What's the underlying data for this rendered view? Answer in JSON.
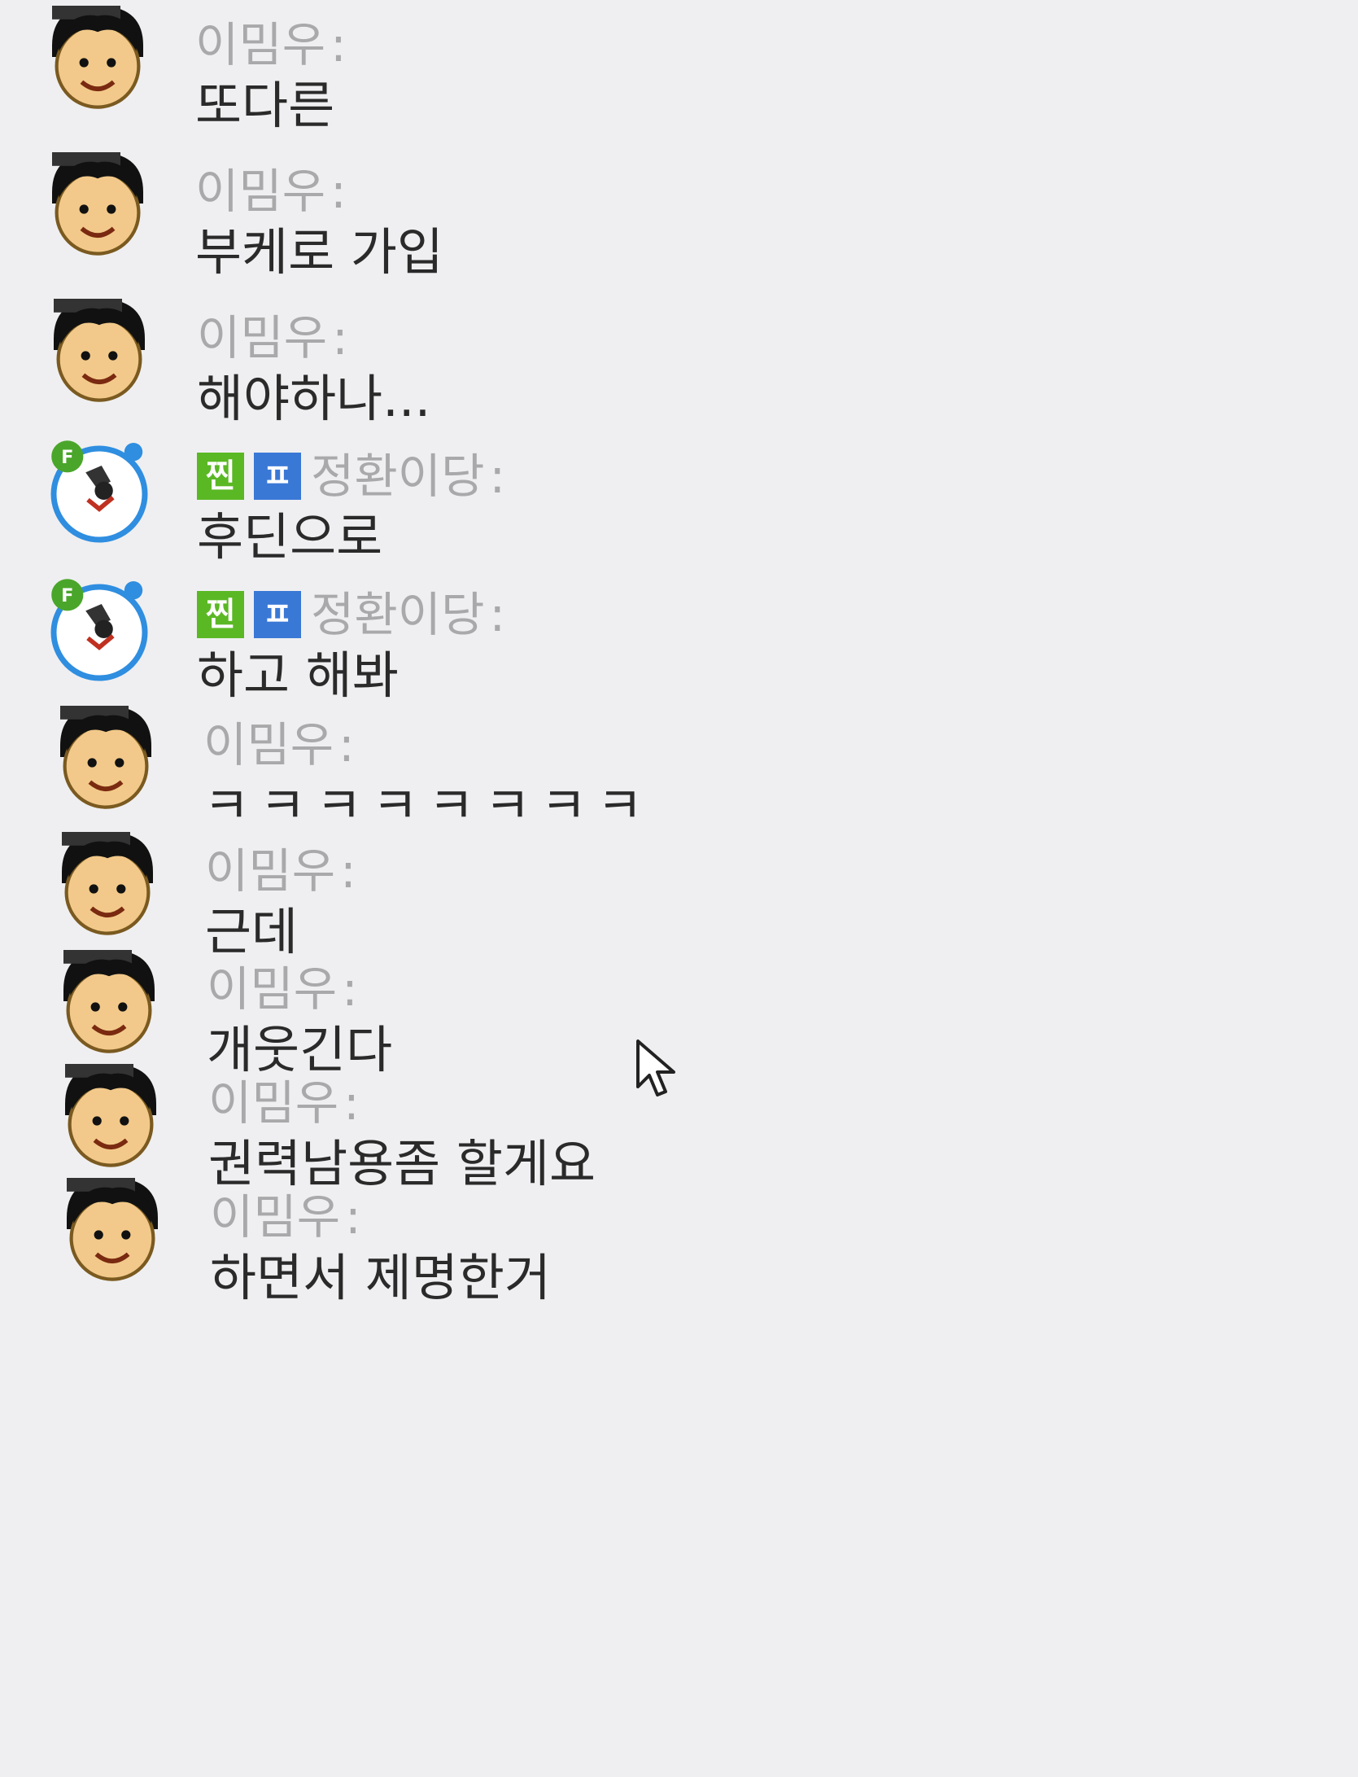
{
  "messages": [
    {
      "sender": "이밈우",
      "separator": ":",
      "text": "또다른",
      "avatar": "boy-face-icon"
    },
    {
      "sender": "이밈우",
      "separator": ":",
      "text": "부케로 가입",
      "avatar": "boy-face-icon"
    },
    {
      "sender": "이밈우",
      "separator": ":",
      "text": "해야하나...",
      "avatar": "boy-face-icon"
    },
    {
      "sender": "정환이당",
      "separator": ":",
      "text": "후딘으로",
      "avatar": "blue-circle-character-icon",
      "badges": [
        "찐",
        "ㅍ"
      ]
    },
    {
      "sender": "정환이당",
      "separator": ":",
      "text": "하고 해봐",
      "avatar": "blue-circle-character-icon",
      "badges": [
        "찐",
        "ㅍ"
      ]
    },
    {
      "sender": "이밈우",
      "separator": ":",
      "text": "ㅋㅋㅋㅋㅋㅋㅋㅋ",
      "avatar": "boy-face-icon"
    },
    {
      "sender": "이밈우",
      "separator": ":",
      "text": "근데",
      "avatar": "boy-face-icon"
    },
    {
      "sender": "이밈우",
      "separator": ":",
      "text": "개웃긴다",
      "avatar": "boy-face-icon"
    },
    {
      "sender": "이밈우",
      "separator": ":",
      "text": "권력남용좀 할게요",
      "avatar": "boy-face-icon"
    },
    {
      "sender": "이밈우",
      "separator": ":",
      "text": "하면서 제명한거",
      "avatar": "boy-face-icon"
    }
  ],
  "colors": {
    "sender": "#a9a9ab",
    "text": "#2a2a2a",
    "badge_green": "#5ab824",
    "badge_blue": "#3a78d6",
    "avatar_ring": "#2f8ee0"
  },
  "cursor_icon": "mouse-pointer-icon"
}
